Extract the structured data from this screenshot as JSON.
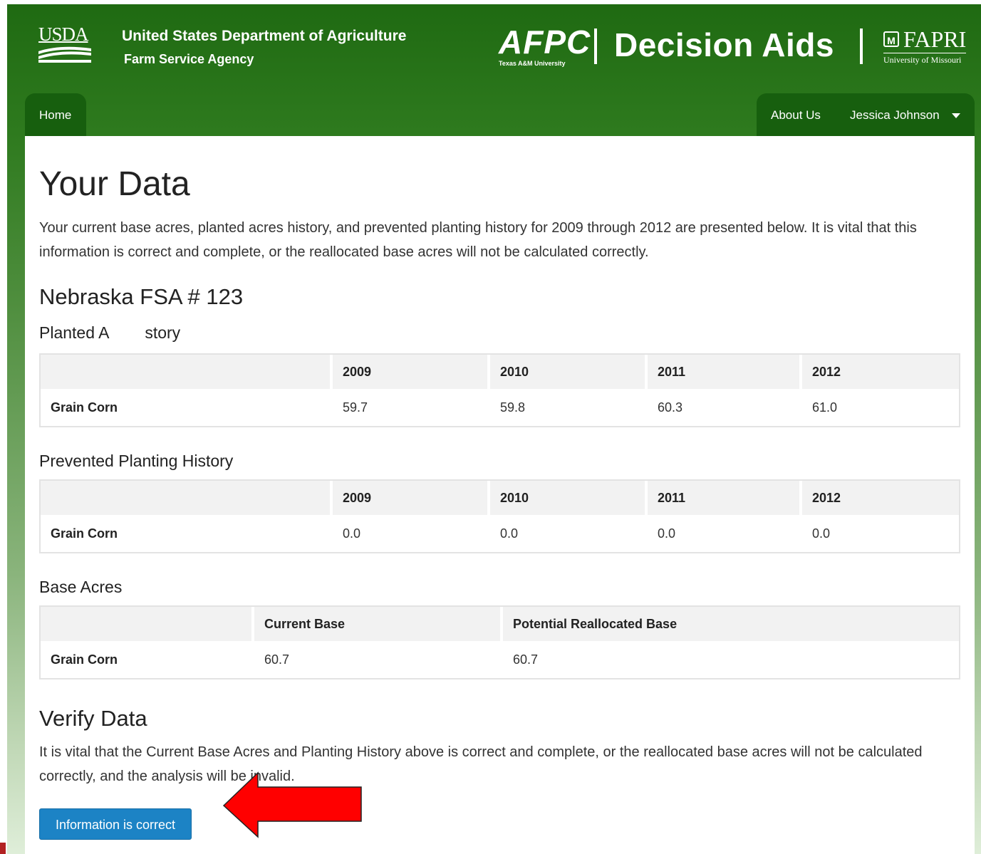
{
  "header": {
    "usda_logo": "USDA",
    "agency_title": "United States Department of Agriculture",
    "agency_sub": "Farm Service Agency",
    "afpc_logo": "AFPC",
    "afpc_sub": "Texas A&M University",
    "app_title": "Decision Aids",
    "fapri_logo": "FAPRI",
    "fapri_sub": "University of Missouri"
  },
  "nav": {
    "home": "Home",
    "about": "About Us",
    "user": "Jessica Johnson",
    "user_menu_icon": "caret-down-icon"
  },
  "page": {
    "title": "Your Data",
    "intro": "Your current base acres, planted acres history, and prevented planting history for 2009 through 2012 are presented below. It is vital that this information is correct and complete, or the reallocated base acres will not be calculated correctly.",
    "farm": "Nebraska FSA # 123"
  },
  "planted": {
    "title": "Planted A        story",
    "headers": [
      "",
      "2009",
      "2010",
      "2011",
      "2012"
    ],
    "row": [
      "Grain Corn",
      "59.7",
      "59.8",
      "60.3",
      "61.0"
    ]
  },
  "prevented": {
    "title": "Prevented Planting History",
    "headers": [
      "",
      "2009",
      "2010",
      "2011",
      "2012"
    ],
    "row": [
      "Grain Corn",
      "0.0",
      "0.0",
      "0.0",
      "0.0"
    ]
  },
  "base": {
    "title": "Base Acres",
    "headers": [
      "",
      "Current Base",
      "Potential Reallocated Base"
    ],
    "row": [
      "Grain Corn",
      "60.7",
      "60.7"
    ]
  },
  "verify": {
    "title": "Verify Data",
    "text": "It is vital that the Current Base Acres and Planting History above is correct and complete, or the reallocated base acres will not be calculated correctly, and the analysis will be invalid.",
    "button": "Information is correct"
  },
  "colors": {
    "header_green": "#1f6a12",
    "nav_green": "#175f0e",
    "button_blue": "#1c83c5",
    "arrow_red": "#ff0000"
  }
}
